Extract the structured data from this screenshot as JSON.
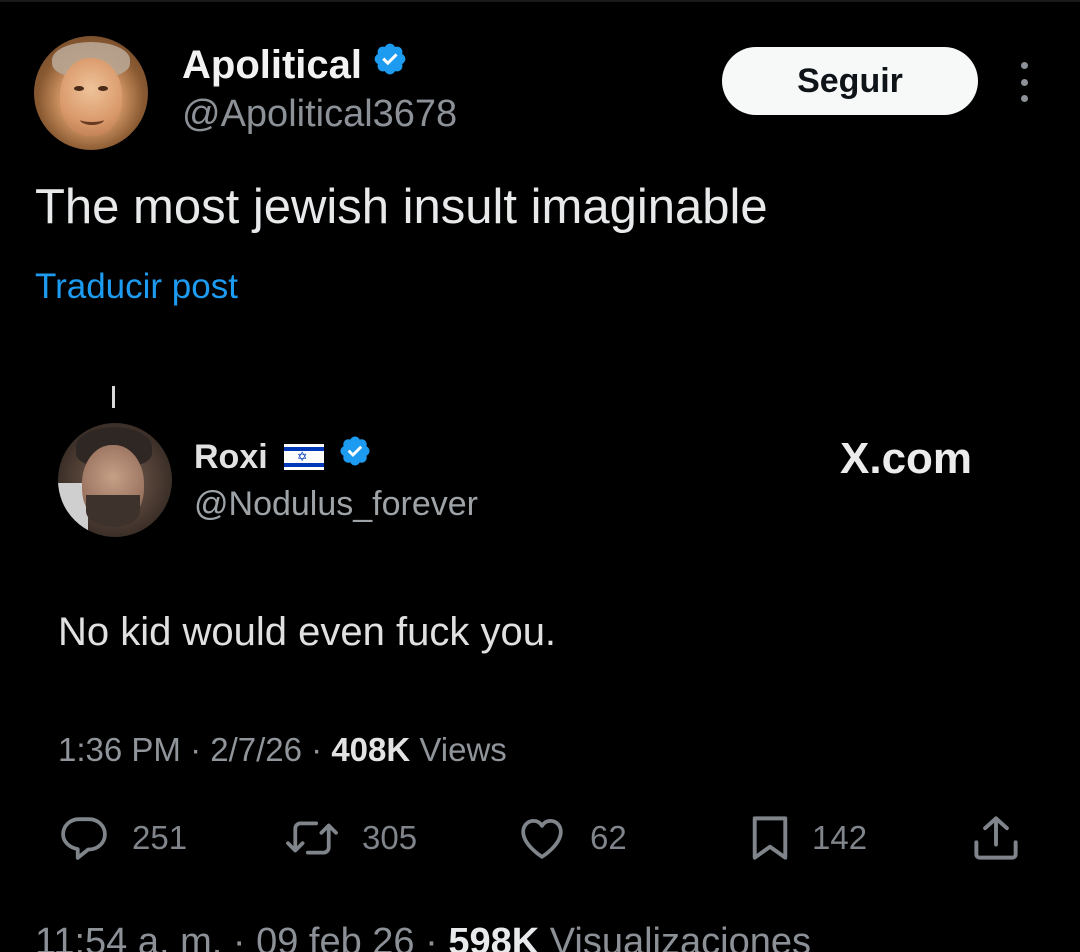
{
  "post": {
    "author": {
      "name": "Apolitical",
      "handle": "@Apolitical3678"
    },
    "follow_label": "Seguir",
    "text": "The most jewish insult imaginable",
    "translate_label": "Traducir post"
  },
  "embedded": {
    "author": {
      "name": "Roxi",
      "handle": "@Nodulus_forever"
    },
    "watermark": "X.com",
    "text": "No kid would even fuck you.",
    "meta": {
      "time": "1:36 PM",
      "date": "2/7/26",
      "views_count": "408K",
      "views_label": "Views"
    },
    "actions": {
      "replies": "251",
      "reposts": "305",
      "likes": "62",
      "bookmarks": "142"
    }
  },
  "footer": {
    "time": "11:54 a. m.",
    "date": "09 feb 26",
    "views_count": "598K",
    "views_label": "Visualizaciones"
  },
  "colors": {
    "background": "#000000",
    "link": "#1d9bf0",
    "verified": "#1d9bf0"
  },
  "icons": [
    "verified-badge-icon",
    "more-options-icon",
    "israel-flag-icon",
    "reply-icon",
    "repost-icon",
    "like-icon",
    "bookmark-icon",
    "share-icon"
  ]
}
